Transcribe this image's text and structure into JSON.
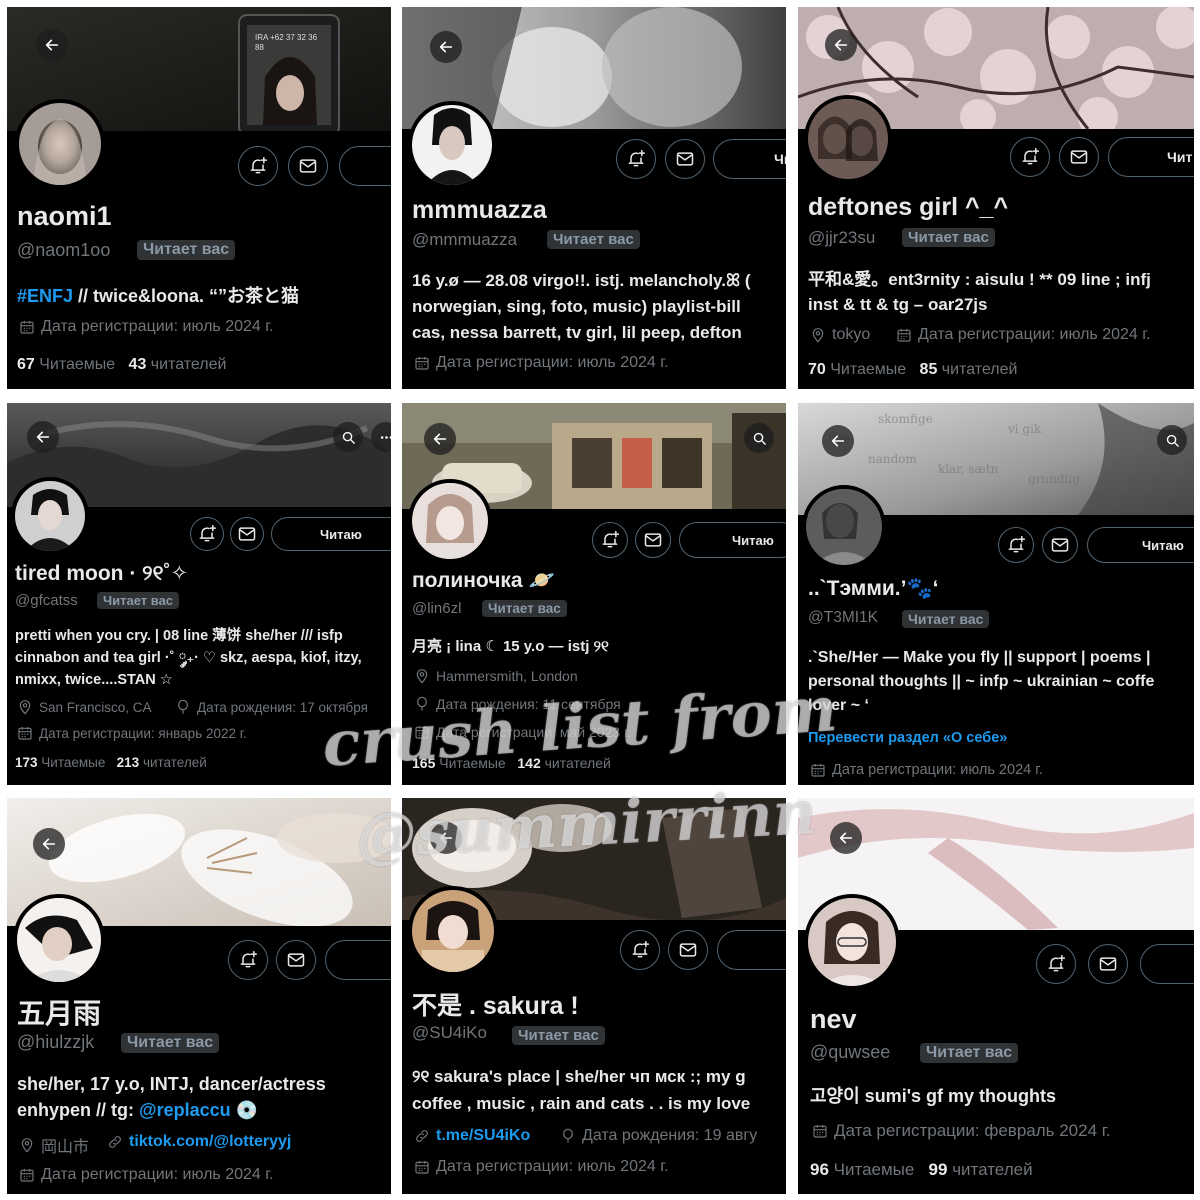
{
  "labels": {
    "follows_you": "Читает вас",
    "following_btn": "Читаю",
    "following_btn_cut": "Чи",
    "following_btn_cut2": "Чит",
    "following_count_label": "Читаемые",
    "followers_count_label": "читателей",
    "translate_bio": "Перевести раздел «О себе»"
  },
  "watermark": {
    "line1": "crush list from",
    "line2": "@summirrinn"
  },
  "colors": {
    "background": "#000000",
    "text": "#e7e9ea",
    "muted": "#71767b",
    "link": "#1d9bf0",
    "badge_bg": "#2f3336"
  },
  "profiles": [
    {
      "name": "naomi1",
      "handle": "@naom1oo",
      "bio_hashtag": "#ENFJ",
      "bio_line1_rest": " // twice&loona. “”お茶と猫",
      "joined": "Дата регистрации: июль 2024 г.",
      "following": "67",
      "followers": "43",
      "banner_phone_text": "IRA +62 37 32 36 88"
    },
    {
      "name": "mmmuazza",
      "handle": "@mmmuazza",
      "bio_line1": "16 y.ø — 28.08 virgo!!. istj. melancholy.ꕤ (",
      "bio_line2": "norwegian, sing, foto, music) playlist-bill",
      "bio_line3": "cas, nessa barrett, tv girl, lil peep, defton",
      "joined": "Дата регистрации: июль 2024 г."
    },
    {
      "name": "deftones girl ^_^",
      "handle": "@jjr23su",
      "bio_line1": "平和&愛。ent3rnity : aisulu ! ** 09 line ; infj",
      "bio_line2": "inst & tt & tg – oar27js",
      "location": "tokyo",
      "joined": "Дата регистрации: июль 2024 г.",
      "following": "70",
      "followers": "85"
    },
    {
      "name": "tired moon · ୨୧˚✧",
      "handle": "@gfcatss",
      "bio_line1": "pretti when you cry. | 08 line 薄饼 she/her /// isfp",
      "bio_line2": "cinnabon and tea girl ·˚ ༘₊· ♡ skz, aespa, kiof, itzy,",
      "bio_line3": "nmixx, twice....STAN ☆",
      "location": "San Francisco, CA",
      "birthday": "Дата рождения: 17 октября",
      "joined": "Дата регистрации: январь 2022 г.",
      "following": "173",
      "followers": "213"
    },
    {
      "name": "полиночка 🪐",
      "handle": "@lin6zl",
      "bio_line1": "月亮 ¡ lina ☾ 15 y.o — istj ୨୧",
      "location": "Hammersmith, London",
      "birthday": "Дата рождения: 11 сентября",
      "joined": "Дата регистрации: май 2023 г.",
      "following": "165",
      "followers": "142"
    },
    {
      "name": "..`Тэмми.’🐾‘",
      "handle": "@T3MI1K",
      "bio_line1": ".`She/Her — Make you fly || support | poems |",
      "bio_line2": "personal thoughts || ~ infp ~ ukrainian ~ coffe",
      "bio_line3": "lover ~ ‘",
      "joined": "Дата регистрации: июль 2024 г."
    },
    {
      "name": "五月雨",
      "handle": "@hiulzzjk",
      "bio_line1": "she/her, 17 y.o, INTJ, dancer/actress",
      "bio_line2_prefix": "enhypen // tg: ",
      "bio_line2_link": "@replaccu",
      "bio_line2_suffix": " 💿",
      "location": "岡山市",
      "website": "tiktok.com/@lotteryyj",
      "joined": "Дата регистрации: июль 2024 г."
    },
    {
      "name": "不是 . sakura !",
      "handle": "@SU4iKo",
      "bio_line1": "୨୧ sakura's place | she/her чп мск :; my g",
      "bio_line2": "coffee , music , rain and cats . . is my love",
      "website": "t.me/SU4iKo",
      "birthday": "Дата рождения: 19 авгу",
      "joined": "Дата регистрации: июль 2024 г."
    },
    {
      "name": "nev",
      "handle": "@quwsee",
      "bio_line1": "고양이 sumi's gf my thoughts",
      "joined": "Дата регистрации: февраль 2024 г.",
      "following": "96",
      "followers": "99"
    }
  ]
}
